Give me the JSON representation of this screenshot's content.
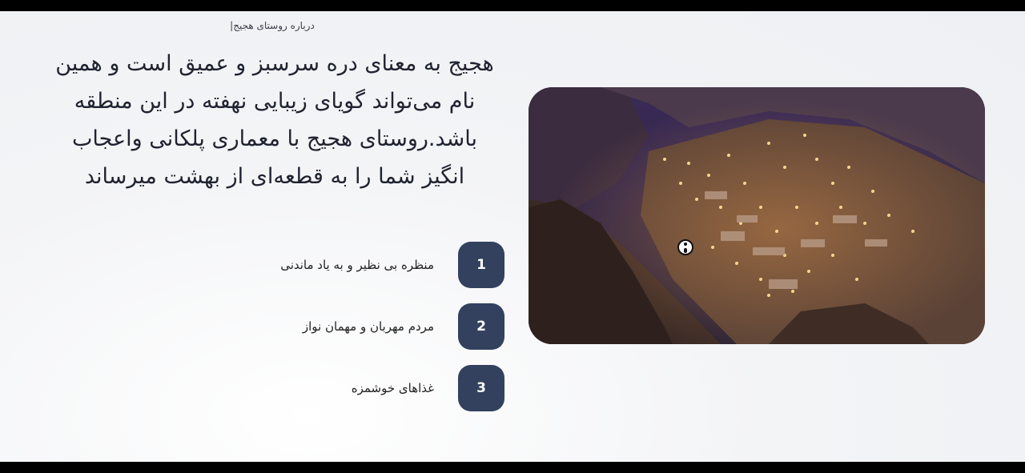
{
  "section": {
    "eyebrow": "درباره روستای هجیج|",
    "heading": "هجیج به معنای دره سرسبز و عمیق است و همین نام می‌تواند گویای زیبایی نهفته در این منطقه باشد.روستای هجیج با معماری پلکانی واعجاب انگیز شما را به قطعه‌ای از بهشت میرساند"
  },
  "features": [
    {
      "number": "1",
      "label": "منظره بی نظیر و به یاد ماندنی"
    },
    {
      "number": "2",
      "label": "مردم مهربان و مهمان نواز"
    },
    {
      "number": "3",
      "label": "غذاهای خوشمزه"
    }
  ],
  "image": {
    "subject": "village-night-photo"
  },
  "colors": {
    "badge": "#33415f",
    "background": "#f3f4f6"
  }
}
